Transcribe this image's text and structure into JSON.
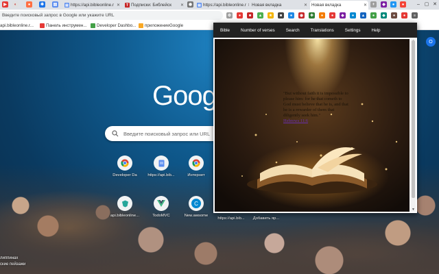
{
  "tabs": [
    {
      "label": "https://api.bibleonline.r",
      "icon": "file-icon",
      "color": "#5b8def"
    },
    {
      "label": "Подписки: Библейск",
      "icon": "red-t-icon",
      "color": "#c62828"
    },
    {
      "label": "https://api.bibleonline.r",
      "icon": "file-icon",
      "color": "#5b8def"
    },
    {
      "label": "Новая вкладка",
      "icon": "chrome-icon",
      "color": "#9e9e9e"
    },
    {
      "label": "Новая вкладка",
      "icon": "chrome-icon",
      "color": "#9e9e9e"
    }
  ],
  "omnibox": {
    "placeholder": "Введите поисковый запрос в Google или укажите URL"
  },
  "bookmarks": [
    {
      "label": "api.bibleonline.r...",
      "color": "#5b8def"
    },
    {
      "label": "Панель инструмен...",
      "color": "#e53935"
    },
    {
      "label": "Developer Dashbo...",
      "color": "#43a047"
    },
    {
      "label": "приложениеGoogle",
      "color": "#f9a825"
    }
  ],
  "ntp": {
    "logo_text": "Goog",
    "search_placeholder": "Введите поисковый запрос или URL",
    "tiles_row1": [
      {
        "label": "Developer Da"
      },
      {
        "label": "https://api.bib..."
      },
      {
        "label": "Интернет"
      }
    ],
    "tiles_row2": [
      {
        "label": "api.bibleonline..."
      },
      {
        "label": "TodoMVC"
      },
      {
        "label": "New.awsome"
      },
      {
        "label": "https://api.bib..."
      },
      {
        "label": "Добавить яр..."
      }
    ],
    "credit_line1": "липпинах",
    "credit_line2": "ские пейзажи"
  },
  "popup": {
    "nav": [
      "Bible",
      "Number of verses",
      "Search",
      "Translations",
      "Settings",
      "Help"
    ],
    "verse_text": "\"But without faith it is impossible to please him: for he that cometh to God must believe that he is, and that he is a rewarder of them that diligently seek him.\"",
    "verse_ref": "Hebrews 11:6"
  },
  "colors": {
    "popup_nav": "#222222",
    "tabstrip": "#dee1e6",
    "ntp_sky": "#1f84c4"
  }
}
